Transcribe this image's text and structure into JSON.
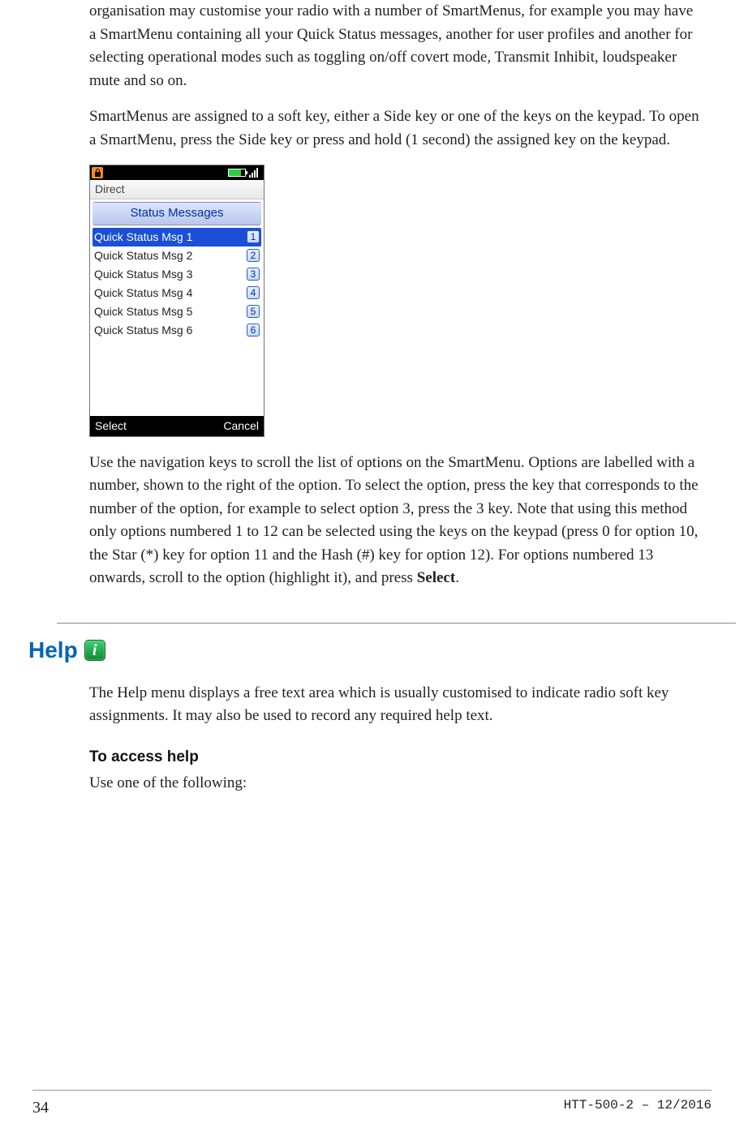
{
  "paragraphs": {
    "intro": "organisation may customise your radio with a number of SmartMenus, for example you may have a SmartMenu containing all your Quick Status messages, another for user profiles and another for selecting operational modes such as toggling on/off covert mode, Transmit Inhibit, loudspeaker mute and so on.",
    "assign": "SmartMenus are assigned to a soft key, either a Side key or one of the keys on the keypad. To open a SmartMenu, press the Side key or press and hold (1 second) the assigned key on the keypad.",
    "nav_a": "Use the navigation keys to scroll the list of options on the SmartMenu. Options are labelled with a number, shown to the right of the option. To select the option, press the key that corresponds to the number of the option, for example to select option 3, press the 3 key. Note that using this method only options numbered 1 to 12 can be selected using the keys on the keypad (press 0 for option 10, the Star (*) key for option 11 and the Hash (#) key for option 12). For options numbered 13 onwards, scroll to the option (highlight it), and press ",
    "nav_b": "Select",
    "nav_c": ".",
    "help_body": "The Help menu displays a free text area which is usually customised to indicate radio soft key assignments. It may also be used to record any required help text.",
    "access_intro": "Use one of the following:"
  },
  "screenshot": {
    "mode": "Direct",
    "title": "Status Messages",
    "items": [
      {
        "label": "Quick Status Msg 1",
        "num": "1",
        "selected": true
      },
      {
        "label": "Quick Status Msg 2",
        "num": "2",
        "selected": false
      },
      {
        "label": "Quick Status Msg 3",
        "num": "3",
        "selected": false
      },
      {
        "label": "Quick Status Msg 4",
        "num": "4",
        "selected": false
      },
      {
        "label": "Quick Status Msg 5",
        "num": "5",
        "selected": false
      },
      {
        "label": "Quick Status Msg 6",
        "num": "6",
        "selected": false
      }
    ],
    "soft_left": "Select",
    "soft_right": "Cancel"
  },
  "headings": {
    "help": "Help",
    "access": "To access help"
  },
  "footer": {
    "page": "34",
    "doc": "HTT-500-2 – 12/2016"
  },
  "help_icon_glyph": "i"
}
